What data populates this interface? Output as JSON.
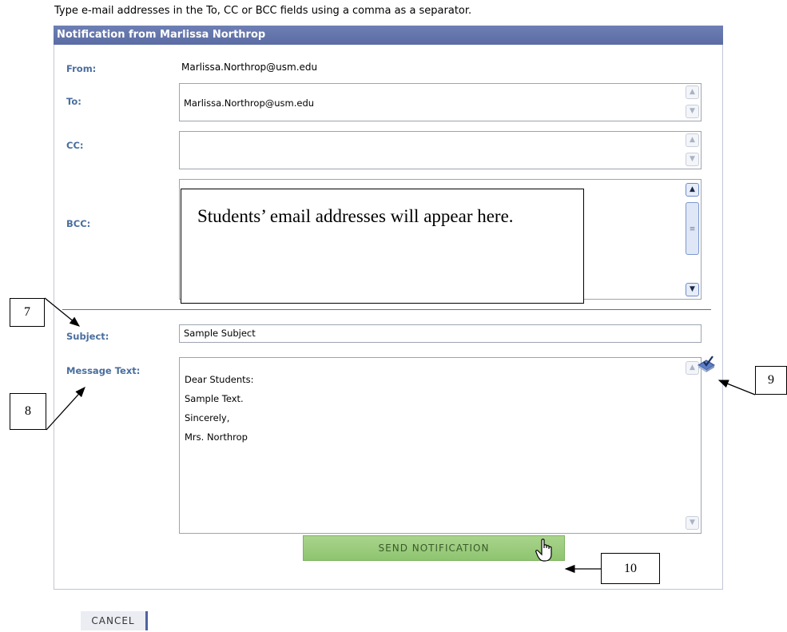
{
  "instructions": "Type e-mail addresses in the To, CC or BCC fields using a comma as a separator.",
  "panel": {
    "title": "Notification from Marlissa Northrop"
  },
  "from": {
    "label": "From:",
    "value": "Marlissa.Northrop@usm.edu"
  },
  "to": {
    "label": "To:",
    "value": "Marlissa.Northrop@usm.edu"
  },
  "cc": {
    "label": "CC:",
    "value": ""
  },
  "bcc": {
    "label": "BCC:",
    "value": ""
  },
  "subject": {
    "label": "Subject:",
    "value": "Sample Subject"
  },
  "message": {
    "label": "Message Text:",
    "value": "Dear Students:\n\nSample Text.\n\nSincerely,\n\nMrs. Northrop"
  },
  "buttons": {
    "send": "SEND NOTIFICATION",
    "cancel": "CANCEL"
  },
  "callouts": {
    "bcc_note": "Students’ email addresses will appear here.",
    "n7": "7",
    "n8": "8",
    "n9": "9",
    "n10": "10"
  },
  "icons": {
    "spellcheck": "spell-check-icon",
    "cursor": "hand-pointer-icon"
  },
  "colors": {
    "header": "#5a6ca3",
    "label": "#4a6e9e",
    "send_button": "#9acb7d"
  }
}
